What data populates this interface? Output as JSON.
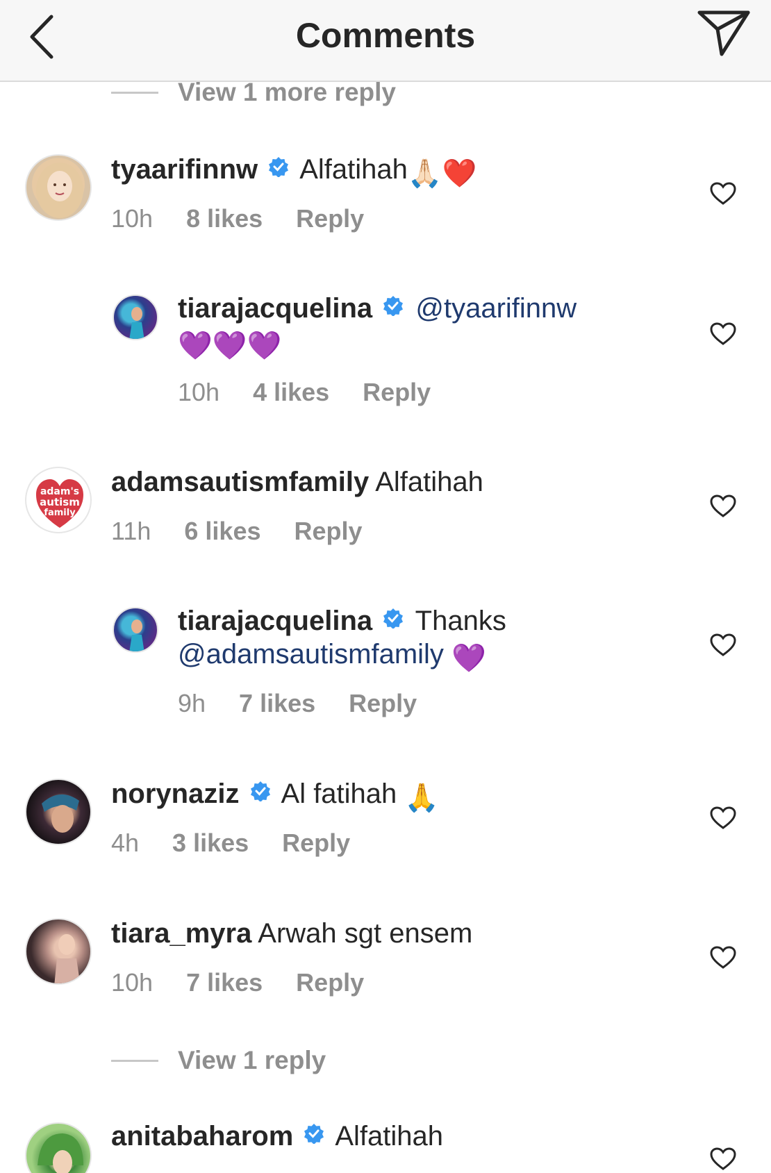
{
  "header": {
    "title": "Comments",
    "back_icon": "chevron-left-icon",
    "send_icon": "paper-plane-icon"
  },
  "view_more_top": "View 1 more reply",
  "view_reply_bottom": "View 1 reply",
  "colors": {
    "verified": "#3897f0",
    "muted": "#8e8e8e",
    "heart_red": "#e0252b",
    "heart_purple": "#9b3fe0"
  },
  "comments": [
    {
      "username": "tyaarifinnw",
      "verified": true,
      "text": "Alfatihah",
      "emoji": "🙏🏻❤️",
      "time": "10h",
      "likes": "8 likes",
      "reply": "Reply"
    },
    {
      "username": "tiarajacquelina",
      "verified": true,
      "mention": "@tyaarifinnw",
      "text": "",
      "emoji": "💜💜💜",
      "time": "10h",
      "likes": "4 likes",
      "reply": "Reply"
    },
    {
      "username": "adamsautismfamily",
      "verified": false,
      "text": "Alfatihah",
      "time": "11h",
      "likes": "6 likes",
      "reply": "Reply",
      "avatar_text": "adam's autism family"
    },
    {
      "username": "tiarajacquelina",
      "verified": true,
      "text": "Thanks",
      "mention": "@adamsautismfamily",
      "emoji": "💜",
      "time": "9h",
      "likes": "7 likes",
      "reply": "Reply"
    },
    {
      "username": "norynaziz",
      "verified": true,
      "text": "Al fatihah",
      "emoji": "🙏",
      "time": "4h",
      "likes": "3 likes",
      "reply": "Reply"
    },
    {
      "username": "tiara_myra",
      "verified": false,
      "text": "Arwah sgt ensem",
      "time": "10h",
      "likes": "7 likes",
      "reply": "Reply"
    },
    {
      "username": "anitabaharom",
      "verified": true,
      "text": "Alfatihah"
    }
  ]
}
